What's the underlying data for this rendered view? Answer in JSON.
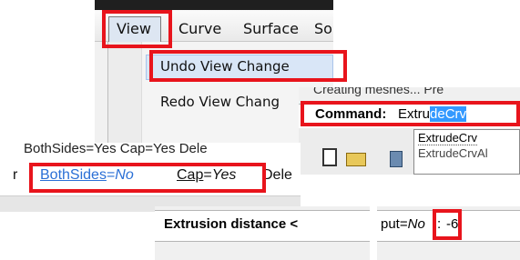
{
  "menu": {
    "bar_items": [
      "View",
      "Curve",
      "Surface",
      "Sol"
    ],
    "view_menu_items": [
      "Undo View Change",
      "Redo View Chang"
    ]
  },
  "command": {
    "top_text": "Creating meshes... Pre",
    "label": "Command:",
    "typed": "Extru",
    "autocomplete": "deCrv",
    "suggestions": [
      "ExtrudeCrv",
      "ExtrudeCrvAl"
    ]
  },
  "options": {
    "prev_line": "BothSides=Yes  Cap=Yes  Dele",
    "bothsides_key": "BothSides",
    "bothsides_val": "No",
    "cap_key": "Cap",
    "cap_val": "Yes",
    "del_key": "Dele",
    "left_stub": "r"
  },
  "extrusion": {
    "label": "Extrusion distance <",
    "input_key": "put=",
    "input_val": "No",
    "colon": ":",
    "value": "-6"
  },
  "colors": {
    "highlight_red": "#e8141c",
    "selection_blue": "#3399ff",
    "link_blue": "#2a6fd6"
  }
}
